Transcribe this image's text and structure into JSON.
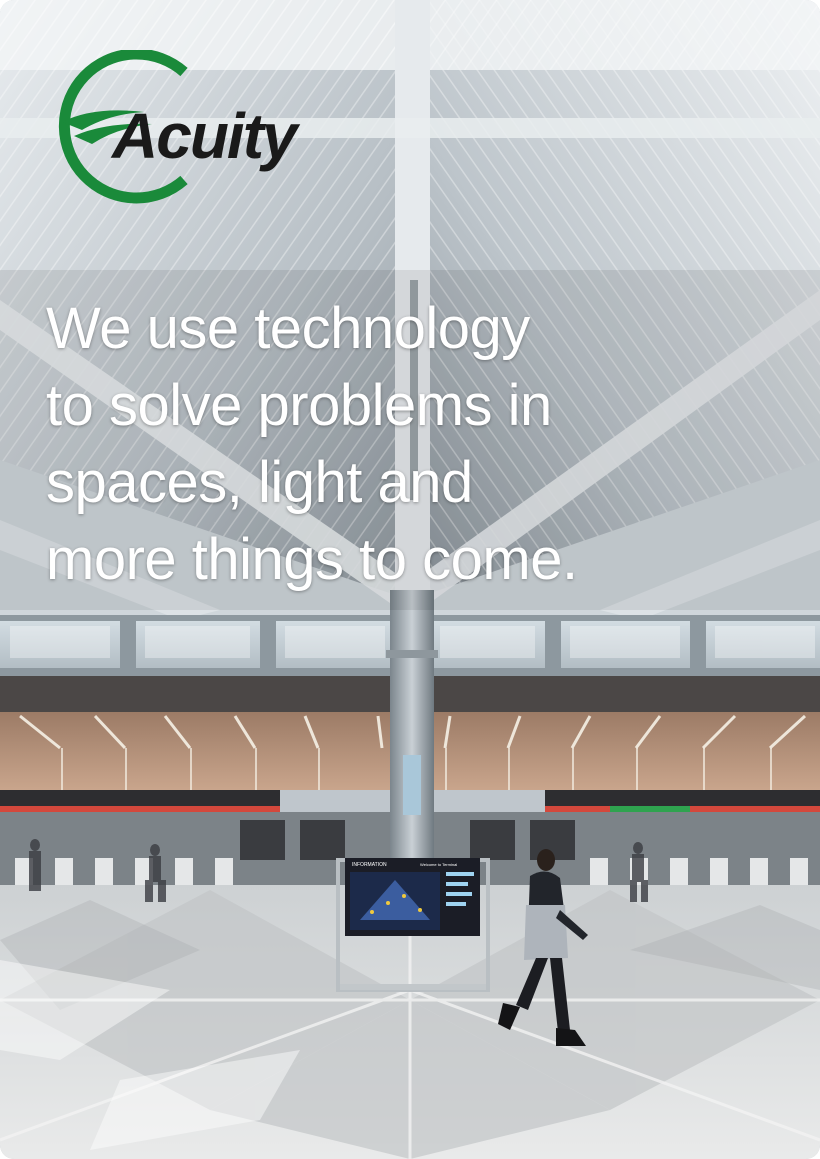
{
  "brand": {
    "logo_text": "Acuity",
    "color_green": "#1a8a3a",
    "color_dark": "#1a1a1a"
  },
  "headline": {
    "lines": [
      "We use technology",
      "to solve problems in",
      "spaces, light and",
      "more things to come."
    ]
  },
  "photo": {
    "signboard_title": "INFORMATION",
    "signboard_subtitle": "Welcome to Terminal"
  }
}
